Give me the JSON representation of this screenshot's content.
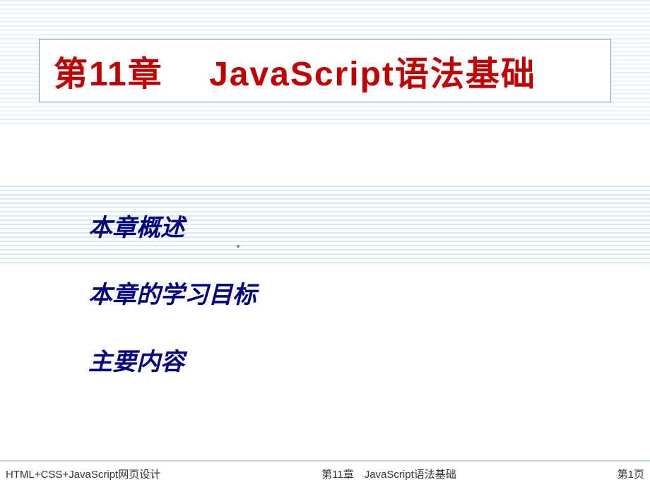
{
  "title": "第11章　 JavaScript语法基础",
  "items": {
    "item1": "本章概述",
    "item2": "本章的学习目标",
    "item3": "主要内容"
  },
  "footer": {
    "left": "HTML+CSS+JavaScript网页设计",
    "center": "第11章　JavaScript语法基础",
    "right": "第1页"
  }
}
